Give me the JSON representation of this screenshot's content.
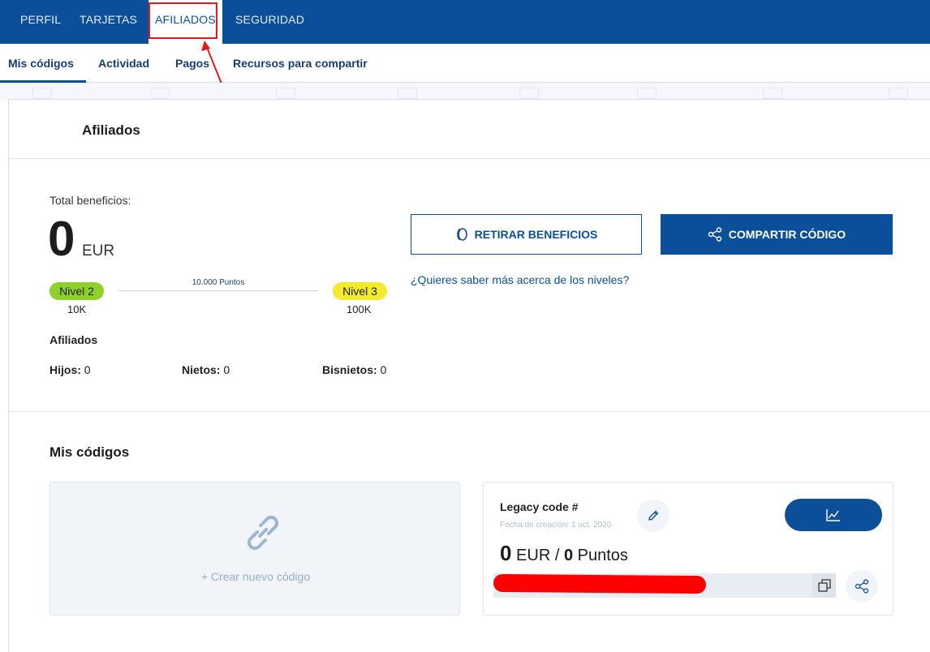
{
  "topnav": {
    "tabs": [
      {
        "label": "PERFIL"
      },
      {
        "label": "TARJETAS"
      },
      {
        "label": "AFILIADOS"
      },
      {
        "label": "SEGURIDAD"
      }
    ],
    "active": "AFILIADOS"
  },
  "subnav": {
    "tabs": [
      {
        "label": "Mis códigos"
      },
      {
        "label": "Actividad"
      },
      {
        "label": "Pagos"
      },
      {
        "label": "Recursos para compartir"
      }
    ],
    "active": "Mis códigos"
  },
  "card": {
    "title": "Afiliados"
  },
  "summary": {
    "total_label": "Total beneficios:",
    "total_value": "0",
    "currency": "EUR",
    "level_current": "Nivel 2",
    "level_current_value": "10K",
    "level_next": "Nivel 3",
    "level_next_value": "100K",
    "points_label": "10.000 Puntos",
    "level_progress_fraction": 0.0
  },
  "affiliates": {
    "heading": "Afiliados",
    "hijos_label": "Hijos:",
    "hijos_value": "0",
    "nietos_label": "Nietos:",
    "nietos_value": "0",
    "bisnietos_label": "Bisnietos:",
    "bisnietos_value": "0"
  },
  "actions": {
    "withdraw_label": "RETIRAR BENEFICIOS",
    "share_label": "COMPARTIR CÓDIGO",
    "levels_link": "¿Quieres saber más acerca de los niveles?"
  },
  "codes": {
    "heading": "Mis códigos",
    "new_code_label": "+  Crear nuevo código",
    "code_title": "Legacy code #",
    "code_date": "Fecha de creación: 1 oct. 2020",
    "code_eur_value": "0",
    "code_eur_unit": "EUR /",
    "code_points_value": "0",
    "code_points_unit": "Puntos"
  },
  "colors": {
    "brand_blue": "#0b4f9a",
    "level2_green": "#8fd12b",
    "level3_yellow": "#f3ea2c",
    "annotation_red": "#e01b1b"
  },
  "icons": {
    "withdraw": "coin-icon",
    "share": "share-icon",
    "link": "link-icon",
    "edit": "pencil-icon",
    "stats": "line-chart-icon",
    "copy": "copy-icon"
  }
}
